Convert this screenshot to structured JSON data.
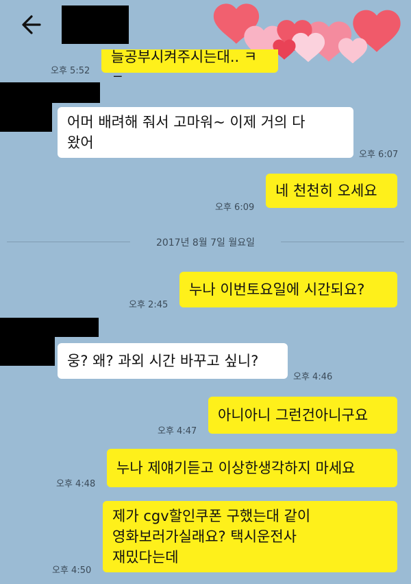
{
  "header": {
    "back_icon": "arrow-left-icon"
  },
  "colors": {
    "background": "#9bbbd4",
    "outgoing_bubble": "#fef01b",
    "incoming_bubble": "#ffffff"
  },
  "messages": [
    {
      "text": "늘공부시켜주시는대.. ㅋㅋ",
      "time": "오후 5:52"
    },
    {
      "text": "어머 배려해 줘서 고마워~ 이제 거의 다\n왔어",
      "time": "오후 6:07"
    },
    {
      "text": "네 천천히 오세요",
      "time": "오후 6:09"
    },
    {
      "text": "누나 이번토요일에 시간되요?",
      "time": "오후 2:45"
    },
    {
      "text": "웅? 왜? 과외 시간 바꾸고 싶니?",
      "time": "오후 4:46"
    },
    {
      "text": "아니아니 그런건아니구요",
      "time": "오후 4:47"
    },
    {
      "text": "누나 제얘기듣고 이상한생각하지 마세요",
      "time": "오후 4:48"
    },
    {
      "text": "제가 cgv할인쿠폰 구했는대 같이\n영화보러가실래요? 택시운전사\n재밌다는데",
      "time": "오후 4:50"
    }
  ],
  "date_divider": "2017년 8월 7일 월요일"
}
